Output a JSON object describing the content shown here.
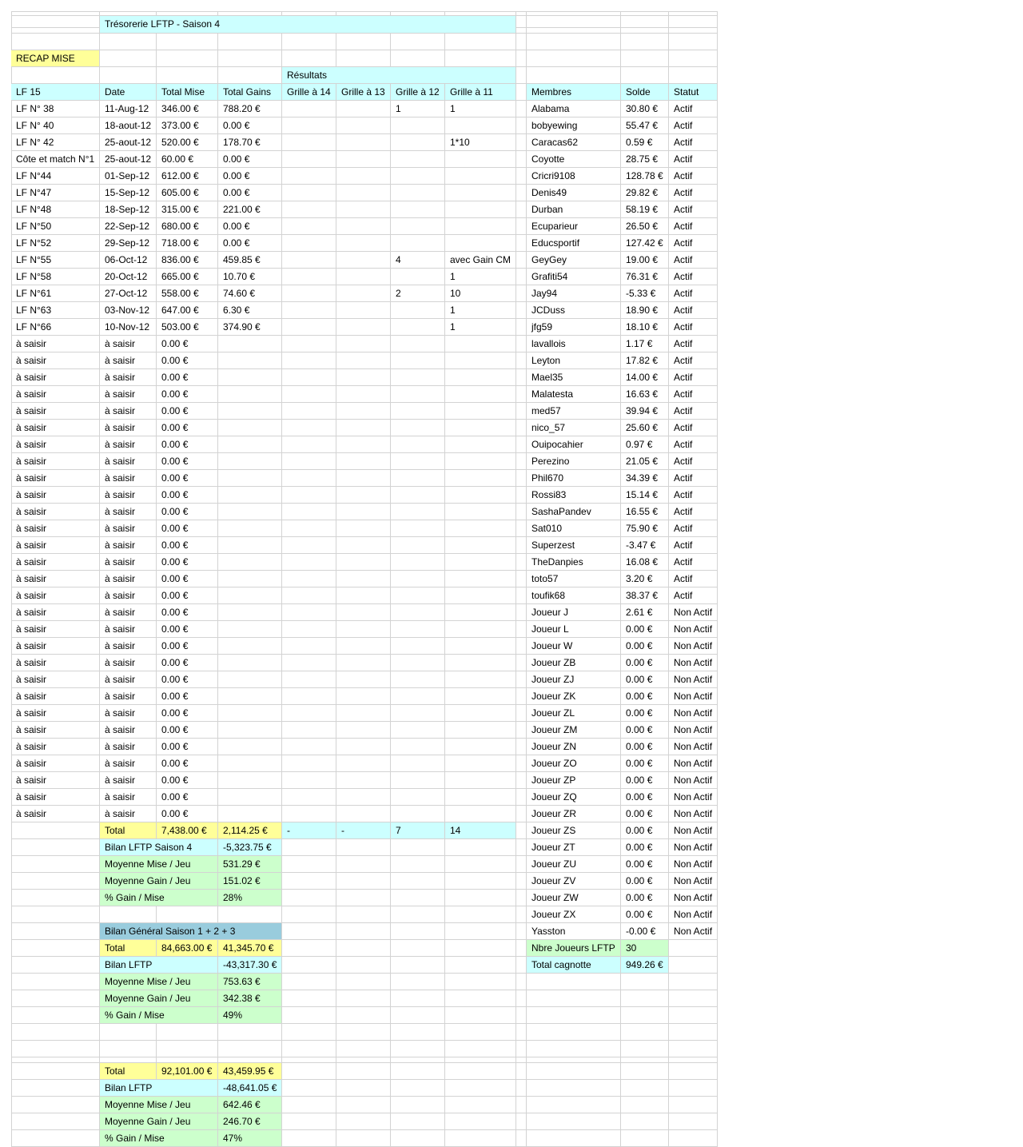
{
  "title": "Trésorerie LFTP - Saison 4",
  "recap_label": "RECAP MISE",
  "resultats_label": "Résultats",
  "headers": [
    "LF 15",
    "Date",
    "Total Mise",
    "Total Gains",
    "Grille à 14",
    "Grille à 13",
    "Grille à 12",
    "Grille à 11"
  ],
  "member_headers": [
    "Membres",
    "Solde",
    "Statut"
  ],
  "games": [
    [
      "LF N° 38",
      "11-Aug-12",
      "346.00 €",
      "788.20 €",
      "",
      "",
      "1",
      "1"
    ],
    [
      "LF N° 40",
      "18-aout-12",
      "373.00 €",
      "0.00 €",
      "",
      "",
      "",
      ""
    ],
    [
      "LF N° 42",
      "25-aout-12",
      "520.00 €",
      "178.70 €",
      "",
      "",
      "",
      "1*10"
    ],
    [
      "Côte et match N°1",
      "25-aout-12",
      "60.00 €",
      "0.00 €",
      "",
      "",
      "",
      ""
    ],
    [
      "LF N°44",
      "01-Sep-12",
      "612.00 €",
      "0.00 €",
      "",
      "",
      "",
      ""
    ],
    [
      "LF N°47",
      "15-Sep-12",
      "605.00 €",
      "0.00 €",
      "",
      "",
      "",
      ""
    ],
    [
      "LF N°48",
      "18-Sep-12",
      "315.00 €",
      "221.00 €",
      "",
      "",
      "",
      ""
    ],
    [
      "LF N°50",
      "22-Sep-12",
      "680.00 €",
      "0.00 €",
      "",
      "",
      "",
      ""
    ],
    [
      "LF N°52",
      "29-Sep-12",
      "718.00 €",
      "0.00 €",
      "",
      "",
      "",
      ""
    ],
    [
      "LF N°55",
      "06-Oct-12",
      "836.00 €",
      "459.85 €",
      "",
      "",
      "4",
      "avec Gain CM"
    ],
    [
      "LF N°58",
      "20-Oct-12",
      "665.00 €",
      "10.70 €",
      "",
      "",
      "",
      "1"
    ],
    [
      "LF N°61",
      "27-Oct-12",
      "558.00 €",
      "74.60 €",
      "",
      "",
      "2",
      "10"
    ],
    [
      "LF N°63",
      "03-Nov-12",
      "647.00 €",
      "6.30 €",
      "",
      "",
      "",
      "1"
    ],
    [
      "LF N°66",
      "10-Nov-12",
      "503.00 €",
      "374.90 €",
      "",
      "",
      "",
      "1"
    ]
  ],
  "placeholder": {
    "label": "à saisir",
    "date": "à saisir",
    "mise": "0.00 €",
    "count": 29
  },
  "members": [
    [
      "Alabama",
      "30.80 €",
      "Actif"
    ],
    [
      "bobyewing",
      "55.47 €",
      "Actif"
    ],
    [
      "Caracas62",
      "0.59 €",
      "Actif"
    ],
    [
      "Coyotte",
      "28.75 €",
      "Actif"
    ],
    [
      "Cricri9108",
      "128.78 €",
      "Actif"
    ],
    [
      "Denis49",
      "29.82 €",
      "Actif"
    ],
    [
      "Durban",
      "58.19 €",
      "Actif"
    ],
    [
      "Ecuparieur",
      "26.50 €",
      "Actif"
    ],
    [
      "Educsportif",
      "127.42 €",
      "Actif"
    ],
    [
      "GeyGey",
      "19.00 €",
      "Actif"
    ],
    [
      "Grafiti54",
      "76.31 €",
      "Actif"
    ],
    [
      "Jay94",
      "-5.33 €",
      "Actif"
    ],
    [
      "JCDuss",
      "18.90 €",
      "Actif"
    ],
    [
      "jfg59",
      "18.10 €",
      "Actif"
    ],
    [
      "lavallois",
      "1.17 €",
      "Actif"
    ],
    [
      "Leyton",
      "17.82 €",
      "Actif"
    ],
    [
      "Mael35",
      "14.00 €",
      "Actif"
    ],
    [
      "Malatesta",
      "16.63 €",
      "Actif"
    ],
    [
      "med57",
      "39.94 €",
      "Actif"
    ],
    [
      "nico_57",
      "25.60 €",
      "Actif"
    ],
    [
      "Ouipocahier",
      "0.97 €",
      "Actif"
    ],
    [
      "Perezino",
      "21.05 €",
      "Actif"
    ],
    [
      "Phil670",
      "34.39 €",
      "Actif"
    ],
    [
      "Rossi83",
      "15.14 €",
      "Actif"
    ],
    [
      "SashaPandev",
      "16.55 €",
      "Actif"
    ],
    [
      "Sat010",
      "75.90 €",
      "Actif"
    ],
    [
      "Superzest",
      "-3.47 €",
      "Actif"
    ],
    [
      "TheDanpies",
      "16.08 €",
      "Actif"
    ],
    [
      "toto57",
      "3.20 €",
      "Actif"
    ],
    [
      "toufik68",
      "38.37 €",
      "Actif"
    ],
    [
      "Joueur J",
      "2.61 €",
      "Non Actif"
    ],
    [
      "Joueur L",
      "0.00 €",
      "Non Actif"
    ],
    [
      "Joueur W",
      "0.00 €",
      "Non Actif"
    ],
    [
      "Joueur ZB",
      "0.00 €",
      "Non Actif"
    ],
    [
      "Joueur ZJ",
      "0.00 €",
      "Non Actif"
    ],
    [
      "Joueur ZK",
      "0.00 €",
      "Non Actif"
    ],
    [
      "Joueur ZL",
      "0.00 €",
      "Non Actif"
    ],
    [
      "Joueur ZM",
      "0.00 €",
      "Non Actif"
    ],
    [
      "Joueur ZN",
      "0.00 €",
      "Non Actif"
    ],
    [
      "Joueur ZO",
      "0.00 €",
      "Non Actif"
    ],
    [
      "Joueur ZP",
      "0.00 €",
      "Non Actif"
    ],
    [
      "Joueur ZQ",
      "0.00 €",
      "Non Actif"
    ],
    [
      "Joueur ZR",
      "0.00 €",
      "Non Actif"
    ],
    [
      "Joueur ZS",
      "0.00 €",
      "Non Actif"
    ],
    [
      "Joueur ZT",
      "0.00 €",
      "Non Actif"
    ],
    [
      "Joueur ZU",
      "0.00 €",
      "Non Actif"
    ],
    [
      "Joueur ZV",
      "0.00 €",
      "Non Actif"
    ],
    [
      "Joueur ZW",
      "0.00 €",
      "Non Actif"
    ],
    [
      "Joueur ZX",
      "0.00 €",
      "Non Actif"
    ],
    [
      "Yasston",
      "-0.00 €",
      "Non Actif"
    ]
  ],
  "members_summary": [
    [
      "Nbre Joueurs LFTP",
      "30"
    ],
    [
      "Total cagnotte",
      "949.26 €"
    ]
  ],
  "season_total": {
    "label": "Total",
    "mise": "7,438.00 €",
    "gains": "2,114.25 €",
    "g14": "-",
    "g13": "-",
    "g12": "7",
    "g11": "14"
  },
  "season_stats": [
    [
      "Bilan LFTP Saison 4",
      "-5,323.75 €"
    ],
    [
      "Moyenne Mise / Jeu",
      "531.29 €"
    ],
    [
      "Moyenne Gain / Jeu",
      "151.02 €"
    ],
    [
      "% Gain / Mise",
      "28%"
    ]
  ],
  "general_title": "Bilan Général Saison 1 + 2 + 3",
  "general_total": [
    "Total",
    "84,663.00 €",
    "41,345.70 €"
  ],
  "general_stats": [
    [
      "Bilan LFTP",
      "-43,317.30 €"
    ],
    [
      "Moyenne Mise / Jeu",
      "753.63 €"
    ],
    [
      "Moyenne Gain / Jeu",
      "342.38 €"
    ],
    [
      "% Gain / Mise",
      "49%"
    ]
  ],
  "overall_total": [
    "Total",
    "92,101.00 €",
    "43,459.95 €"
  ],
  "overall_stats": [
    [
      "Bilan LFTP",
      "-48,641.05 €"
    ],
    [
      "Moyenne Mise / Jeu",
      "642.46 €"
    ],
    [
      "Moyenne Gain / Jeu",
      "246.70 €"
    ],
    [
      "% Gain / Mise",
      "47%"
    ]
  ],
  "colors": {
    "header": "#ccffff",
    "highlight": "#ffff99",
    "stats": "#ccffcc",
    "general": "#99ccdd",
    "grid": "#d3d3d3"
  }
}
